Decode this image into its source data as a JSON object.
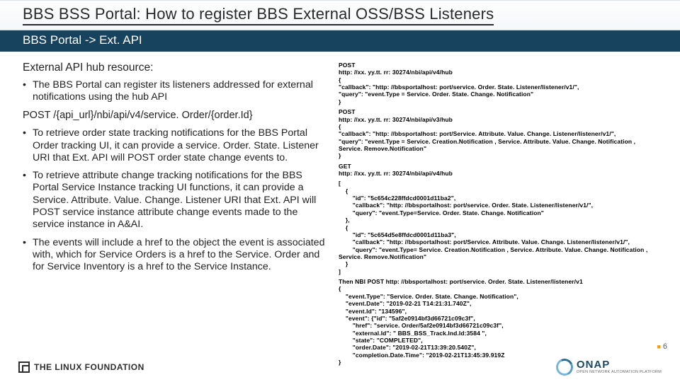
{
  "title": "BBS BSS Portal: How to register BBS External OSS/BSS Listeners",
  "subtitle": "BBS Portal -> Ext. API",
  "left": {
    "heading": "External API hub resource:",
    "b1": "The BBS Portal can register its listeners addressed for external notifications using the hub API",
    "post_line": "POST /{api_url}/nbi/api/v4/service. Order/{order.Id}",
    "b2": "To retrieve order state tracking notifications for the BBS Portal Order tracking UI, it can provide a service. Order. State. Listener URI that Ext. API will POST order state change events to.",
    "b3": "To retrieve attribute change tracking notifications for the BBS Portal Service Instance tracking UI functions, it can provide a Service. Attribute. Value. Change. Listener URI that Ext. API will POST service instance attribute change events made to the service instance in A&AI.",
    "b4": "The events will include a href to the object the event is associated with, which for Service Orders is a href to the Service. Order and for Service Inventory is a href to the Service Instance."
  },
  "right": {
    "block1": "POST\nhttp: //xx. yy.tt. rr: 30274/nbi/api/v4/hub\n{\n\"callback\": \"http: //bbsportalhost: port/service. Order. State. Listener/listener/v1/\",\n\"query\": \"event.Type = Service. Order. State. Change. Notification\"\n}",
    "block2": "POST\nhttp: //xx. yy.tt. rr: 30274/nbi/api/v3/hub\n{\n\"callback\": \"http: //bbsportalhost: port/Service. Attribute. Value. Change. Listener/listener/v1/\",\n\"query\": \"event.Type = Service. Creation.Notification , Service. Attribute. Value. Change. Notification ,\nService. Remove.Notification\"\n}",
    "block3": "GET\nhttp: //xx. yy.tt. rr: 30274/nbi/api/v4/hub",
    "block4": "[\n    {\n        \"id\": \"5c654c228ffdcd0001d11ba2\",\n        \"callback\": \"http: //bbsportalhost: port/service. Order. State. Listener/listener/v1/\",\n        \"query\": \"event.Type=Service. Order. State. Change. Notification\"\n    },\n    {\n        \"id\": \"5c654d5e8ffdcd0001d11ba3\",\n        \"callback\": \"http: //bbsportalhost: port/Service. Attribute. Value. Change. Listener/listener/v1/\",\n        \"query\": \"event.Type= Service. Creation.Notification , Service. Attribute. Value. Change. Notification ,\nService. Remove.Notification\"\n    }\n]",
    "block5": "Then NBI POST http: //bbsportalhost: port/service. Order. State. Listener/listener/v1\n{\n    \"event.Type\": \"Service. Order. State. Change. Notification\",\n    \"event.Date\": \"2019-02-21 T14:21:31.740Z\",\n    \"event.Id\": \"134596\",\n    \"event\": {\"id\": \"5af2e0914bf3d66721c09c3f\",\n        \"href\": \"service. Order/5af2e0914bf3d66721c09c3f\",\n        \"external.Id\": \" BBS_BSS_Track.Ind.Id:3584 \",\n        \"state\": \"COMPLETED\",\n        \"order.Date\": \"2019-02-21T13:39:20.540Z\",\n        \"completion.Date.Time\": \"2019-02-21T13:45:39.919Z\n}"
  },
  "page": "6",
  "footer": {
    "linux": "THE LINUX FOUNDATION",
    "onap": "ONAP",
    "onap_sub": "OPEN NETWORK AUTOMATION PLATFORM"
  }
}
